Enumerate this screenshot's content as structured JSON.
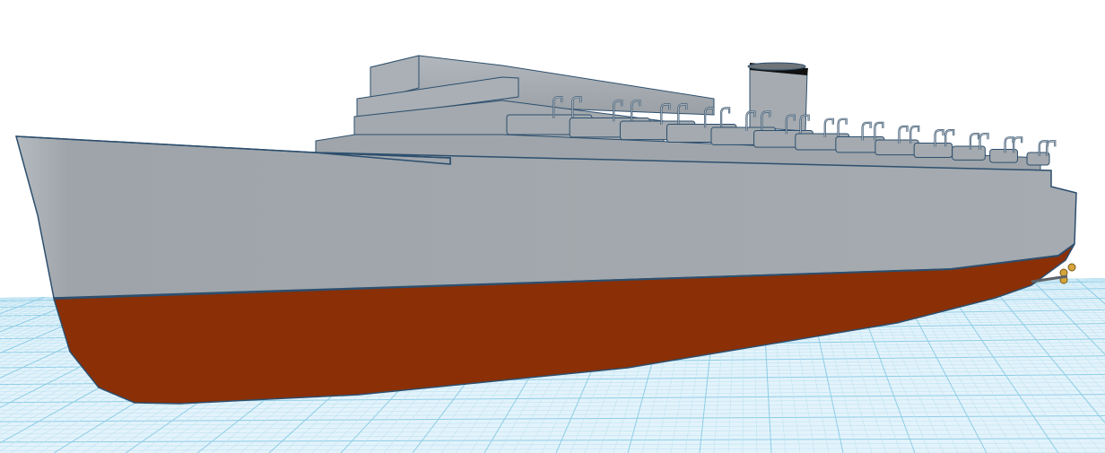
{
  "viewport": {
    "background": "#ffffff"
  },
  "workplane": {
    "fill": "#e3f3fb",
    "grid_minor": "#bfe3f2",
    "grid_major": "#8ecde6"
  },
  "model": {
    "hull_upper_color": "#a3a9ae",
    "hull_lower_color": "#8a2f06",
    "edge_color": "#2d4f6e",
    "funnel_band_color": "#111111",
    "lifeboat_count": 13,
    "propeller_color": "#d6a53a"
  }
}
